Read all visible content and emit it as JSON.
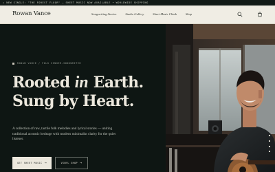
{
  "announcement": "✦ NEW SINGLE: \"THE FOREST FLOOR\" — SHEET MUSIC NOW AVAILABLE • WORLDWIDE SHIPPING",
  "brand": {
    "logo": "Rowan Vance"
  },
  "nav": {
    "links": [
      "Songwriting Stories",
      "Studio Gallery",
      "Sheet Music Climb",
      "Shop"
    ],
    "search_icon": "search-icon",
    "cart_icon": "shopping-bag-icon"
  },
  "hero": {
    "eyebrow": "ROWAN VANCE / FOLK SINGER-SONGWRITER",
    "headline_line1_start": "Rooted ",
    "headline_line1_italic": "in",
    "headline_line1_end": " Earth.",
    "headline_line2": "Sung by Heart.",
    "description": "A collection of raw, tactile folk melodies and lyrical stories — uniting traditional acoustic heritage with modern minimalist clarity for the quiet listener.",
    "primary_button": "GET SHEET MUSIC",
    "secondary_button": "VINYL SHOP",
    "arrow": "→"
  },
  "colors": {
    "background": "#0e1613",
    "nav_background": "#f0ede4",
    "cream": "#ece8dd"
  }
}
